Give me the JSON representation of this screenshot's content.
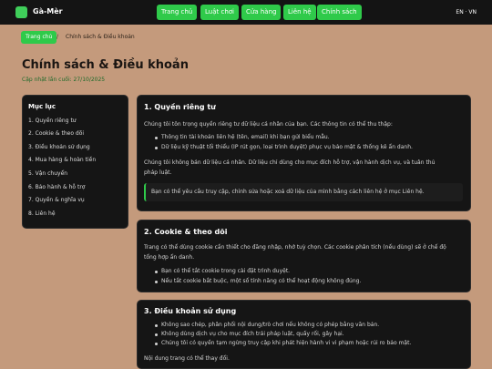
{
  "brand": {
    "name": "Gà-Mèr"
  },
  "nav": [
    "Trang chủ",
    "Luật chơi",
    "Cửa hàng",
    "Liên hệ",
    "Chính sách"
  ],
  "lang": "EN · VN",
  "breadcrumb": {
    "home": "Trang chủ",
    "sep": "/",
    "current": "Chính sách & Điều khoản"
  },
  "page": {
    "title": "Chính sách & Điều khoản",
    "updated": "Cập nhật lần cuối: 27/10/2025"
  },
  "toc": {
    "title": "Mục lục",
    "items": [
      "1. Quyền riêng tư",
      "2. Cookie & theo dõi",
      "3. Điều khoản sử dụng",
      "4. Mua hàng & hoàn tiền",
      "5. Vận chuyển",
      "6. Bảo hành & hỗ trợ",
      "7. Quyền & nghĩa vụ",
      "8. Liên hệ"
    ]
  },
  "sections": {
    "privacy": {
      "title": "1. Quyền riêng tư",
      "intro": "Chúng tôi tôn trọng quyền riêng tư dữ liệu cá nhân của bạn. Các thông tin có thể thu thập:",
      "bullets": [
        "Thông tin tài khoản liên hệ (tên, email) khi bạn gửi biểu mẫu.",
        "Dữ liệu kỹ thuật tối thiểu (IP rút gọn, loại trình duyệt) phục vụ bảo mật & thống kê ẩn danh."
      ],
      "body_line1": "Chúng tôi không bán dữ liệu cá nhân. Dữ liệu chỉ dùng cho mục đích hỗ trợ, vận hành dịch vụ, và tuân thủ",
      "body_line2": "pháp luật.",
      "note": "Bạn có thể yêu cầu truy cập, chỉnh sửa hoặc xoá dữ liệu của mình bằng cách liên hệ ở mục Liên hệ."
    },
    "cookie": {
      "title": "2. Cookie & theo dõi",
      "intro_line1": "Trang có thể dùng cookie cần thiết cho đăng nhập, nhớ tuỳ chọn. Các cookie phân tích (nếu dùng) sẽ ở chế độ",
      "intro_line2": "tổng hợp ẩn danh.",
      "bullets": [
        "Bạn có thể tắt cookie trong cài đặt trình duyệt.",
        "Nếu tắt cookie bắt buộc, một số tính năng có thể hoạt động không đúng."
      ]
    },
    "terms": {
      "title": "3. Điều khoản sử dụng",
      "bullets": [
        "Không sao chép, phân phối nội dung/trò chơi nếu không có phép bằng văn bản.",
        "Không dùng dịch vụ cho mục đích trái pháp luật, quấy rối, gây hại.",
        "Chúng tôi có quyền tạm ngừng truy cập khi phát hiện hành vi vi phạm hoặc rủi ro bảo mật."
      ],
      "footer": "Nội dung trang có thể thay đổi."
    }
  },
  "colors": {
    "accent": "#2fca4a",
    "background": "#c49a7c",
    "card": "#151515"
  }
}
